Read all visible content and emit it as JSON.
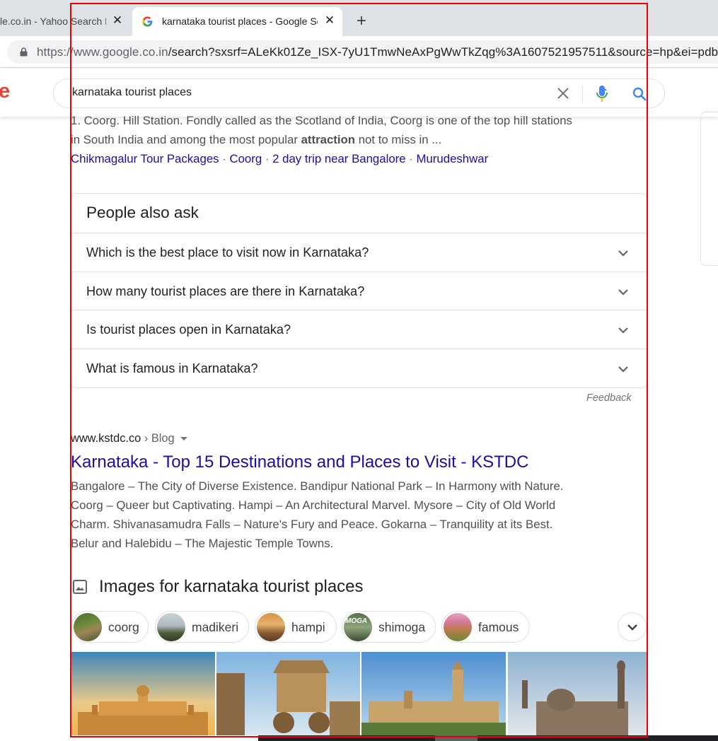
{
  "browser": {
    "tabs": [
      {
        "title": "le.co.in - Yahoo Search Results",
        "close": "✕"
      },
      {
        "title": "karnataka tourist places - Google Search",
        "close": "✕"
      }
    ],
    "new_tab": "+",
    "url_host": "https://www.google.co.in",
    "url_path": "/search?sxsrf=ALeKk01Ze_ISX-7yU1TmwNeAxPgWwTkZqg%3A1607521957511&source=hp&ei=pdb"
  },
  "google": {
    "logo_fragment": "e",
    "search_value": "karnataka tourist places"
  },
  "top_result": {
    "snippet_line1": "1. Coorg. Hill Station. Fondly called as the Scotland of India, Coorg is one of the top hill stations",
    "snippet_line2_pre": "in South India and among the most popular ",
    "snippet_line2_bold": "attraction",
    "snippet_line2_post": " not to miss in ...",
    "sitelinks": [
      "Chikmagalur Tour Packages",
      "Coorg",
      "2 day trip near Bangalore",
      "Murudeshwar"
    ],
    "separator": " · "
  },
  "people_also_ask": {
    "title": "People also ask",
    "questions": [
      "Which is the best place to visit now in Karnataka?",
      "How many tourist places are there in Karnataka?",
      "Is tourist places open in Karnataka?",
      "What is famous in Karnataka?"
    ],
    "feedback": "Feedback"
  },
  "kstdc_result": {
    "cite_domain": "www.kstdc.co",
    "cite_crumb": " › Blog",
    "title": "Karnataka - Top 15 Destinations and Places to Visit - KSTDC",
    "snippet_lines": [
      "Bangalore – The City of Diverse Existence. Bandipur National Park – In Harmony with Nature.",
      "Coorg – Queer but Captivating. Hampi – An Architectural Marvel. Mysore – City of Old World",
      "Charm. Shivanasamudra Falls – Nature's Fury and Peace. Gokarna – Tranquility at its Best.",
      "Belur and Halebidu – The Majestic Temple Towns."
    ]
  },
  "images": {
    "heading": "Images for karnataka tourist places",
    "chips": [
      "coorg",
      "madikeri",
      "hampi",
      "shimoga",
      "famous"
    ],
    "thumb_overlay_text": "MOGA"
  },
  "colors": {
    "link": "#1a0dab",
    "snippet": "#4d5156",
    "annotation_frame": "#ee0000"
  }
}
